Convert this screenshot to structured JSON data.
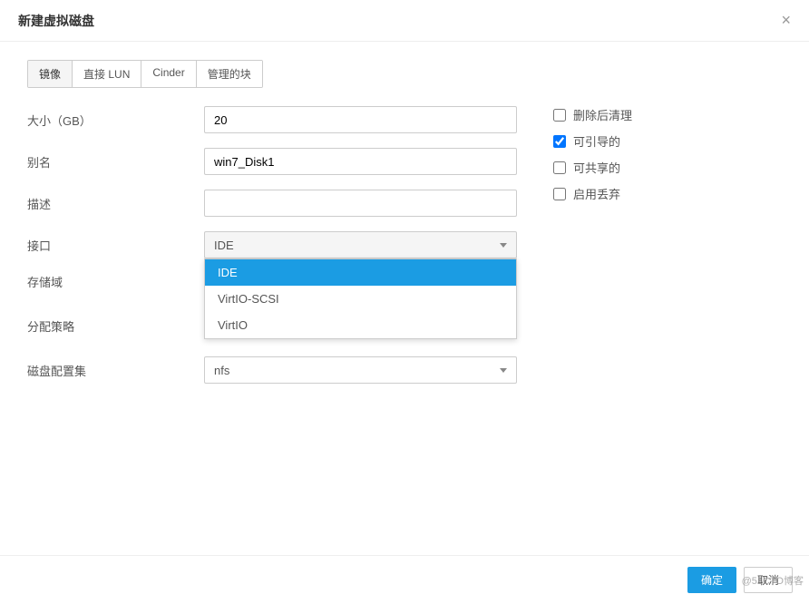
{
  "header": {
    "title": "新建虚拟磁盘",
    "close_symbol": "×"
  },
  "tabs": [
    {
      "label": "镜像"
    },
    {
      "label": "直接 LUN"
    },
    {
      "label": "Cinder"
    },
    {
      "label": "管理的块"
    }
  ],
  "form": {
    "size": {
      "label": "大小（GB）",
      "value": "20"
    },
    "alias": {
      "label": "别名",
      "value": "win7_Disk1"
    },
    "description": {
      "label": "描述",
      "value": ""
    },
    "interface": {
      "label": "接口",
      "value": "IDE",
      "options": [
        "IDE",
        "VirtIO-SCSI",
        "VirtIO"
      ]
    },
    "storage_domain": {
      "label": "存储域",
      "value": ""
    },
    "alloc_policy": {
      "label": "分配策略",
      "value": ""
    },
    "disk_profile": {
      "label": "磁盘配置集",
      "value": "nfs"
    }
  },
  "checkboxes": {
    "wipe_after_delete": {
      "label": "删除后清理",
      "checked": false
    },
    "bootable": {
      "label": "可引导的",
      "checked": true
    },
    "shareable": {
      "label": "可共享的",
      "checked": false
    },
    "enable_discard": {
      "label": "启用丢弃",
      "checked": false
    }
  },
  "footer": {
    "confirm": "确定",
    "cancel": "取消"
  },
  "watermark": "@51CTO博客"
}
